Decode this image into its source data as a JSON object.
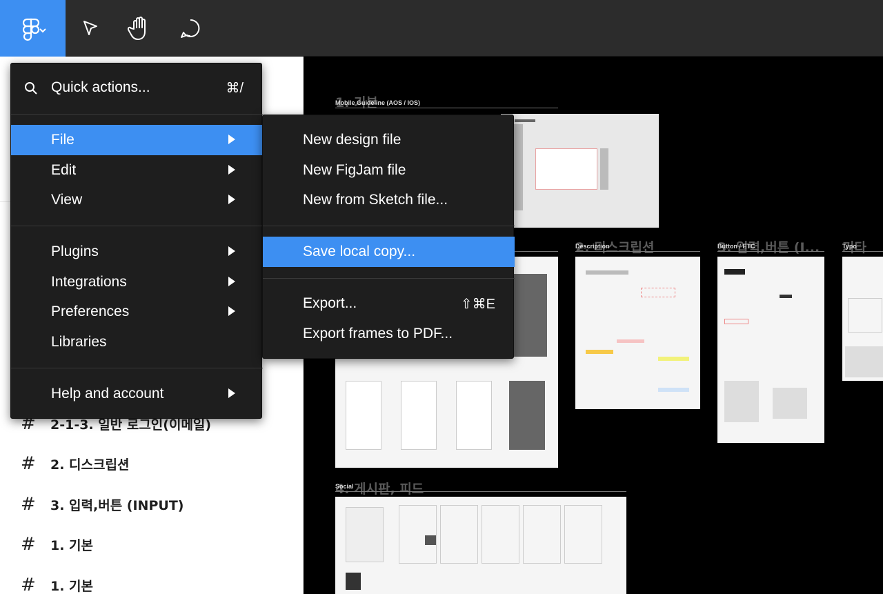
{
  "toolbar": {
    "tools": [
      {
        "name": "main-menu",
        "icon": "figma-logo-icon",
        "active": true
      },
      {
        "name": "move",
        "icon": "cursor-arrow-icon"
      },
      {
        "name": "hand",
        "icon": "hand-icon"
      },
      {
        "name": "comment",
        "icon": "comment-icon"
      }
    ],
    "accent_color": "#3d8ff2"
  },
  "main_menu": {
    "quick_actions": {
      "label": "Quick actions...",
      "shortcut": "⌘/"
    },
    "items": [
      {
        "label": "File",
        "has_submenu": true,
        "active": true
      },
      {
        "label": "Edit",
        "has_submenu": true
      },
      {
        "label": "View",
        "has_submenu": true
      },
      {
        "label": "Plugins",
        "has_submenu": true
      },
      {
        "label": "Integrations",
        "has_submenu": true
      },
      {
        "label": "Preferences",
        "has_submenu": true
      },
      {
        "label": "Libraries",
        "has_submenu": false
      },
      {
        "label": "Help and account",
        "has_submenu": true
      }
    ]
  },
  "file_submenu": {
    "items": [
      {
        "label": "New design file"
      },
      {
        "label": "New FigJam file"
      },
      {
        "label": "New from Sketch file..."
      },
      {
        "label": "Save local copy...",
        "active": true
      },
      {
        "label": "Export...",
        "shortcut": "⇧⌘E"
      },
      {
        "label": "Export frames to PDF..."
      }
    ]
  },
  "layers": [
    {
      "label": "2-1-3. 일반 로그인(이메일)",
      "icon": "frame-hash-icon"
    },
    {
      "label": "2. 디스크립션",
      "icon": "frame-hash-icon"
    },
    {
      "label": "3. 입력,버튼 (INPUT)",
      "icon": "frame-hash-icon"
    },
    {
      "label": "1. 기본",
      "icon": "frame-hash-icon"
    },
    {
      "label": "1. 기본",
      "icon": "frame-hash-icon"
    }
  ],
  "canvas": {
    "frames": [
      {
        "title": "Mobile Guideline (AOS / IOS)",
        "ghost": "1. 기본"
      },
      {
        "title": "Description",
        "ghost": "2. 디스크립션"
      },
      {
        "title": "Button / ETC",
        "ghost": "3. 입력,버튼 (I..."
      },
      {
        "title": "Typo",
        "ghost": "기타"
      },
      {
        "title": "Social",
        "ghost": "4. 게시판, 피드"
      }
    ]
  }
}
